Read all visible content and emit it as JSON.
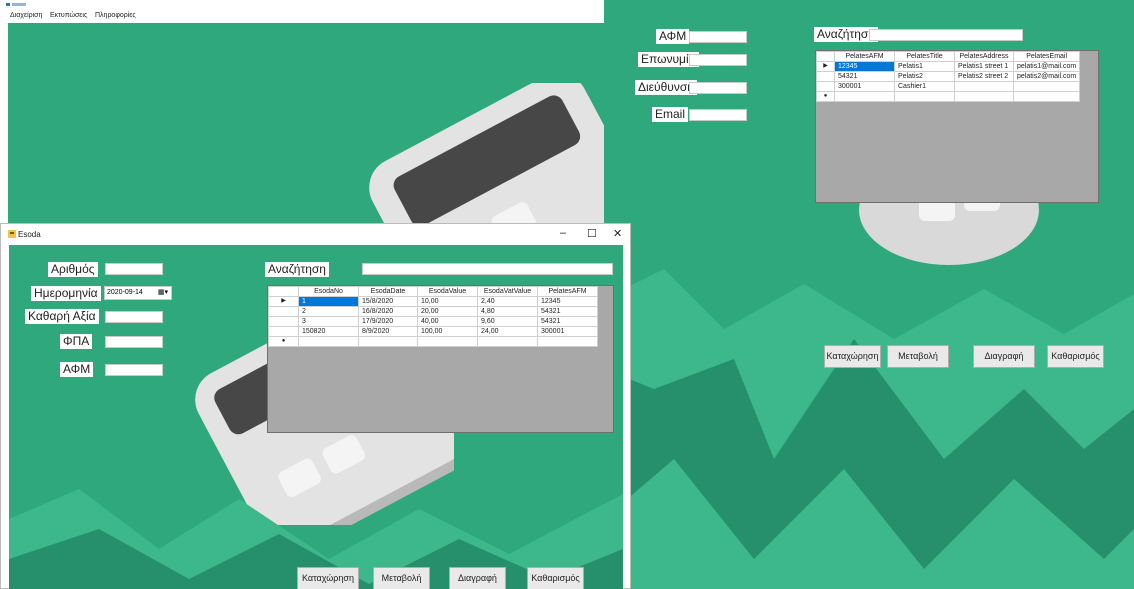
{
  "main": {
    "menu": [
      "Διαχείριση",
      "Εκτυπώσεις",
      "Πληροφορίες"
    ]
  },
  "pelates": {
    "labels": {
      "afm": "ΑΦΜ",
      "eponymia": "Επωνυμία",
      "dieythynsi": "Διεύθυνση",
      "email": "Email",
      "search": "Αναζήτηση"
    },
    "grid": {
      "columns": [
        "PelatesAFM",
        "PelatesTitle",
        "PelatesAddress",
        "PelatesEmail"
      ],
      "rows": [
        [
          "12345",
          "Pelatis1",
          "Pelatis1 street 1",
          "pelatis1@mail.com"
        ],
        [
          "54321",
          "Pelatis2",
          "Pelatis2 street 2",
          "pelatis2@mail.com"
        ],
        [
          "300001",
          "Cashier1",
          "",
          ""
        ]
      ]
    },
    "buttons": {
      "insert": "Καταχώρηση",
      "update": "Μεταβολή",
      "delete": "Διαγραφή",
      "clear": "Καθαρισμός"
    }
  },
  "esoda": {
    "title": "Esoda",
    "labels": {
      "arithmos": "Αριθμός",
      "imerominia": "Ημερομηνία",
      "kathari_axia": "Καθαρή Αξία",
      "fpa": "ΦΠΑ",
      "afm": "ΑΦΜ",
      "search": "Αναζήτηση"
    },
    "date_value": "2020-09-14",
    "grid": {
      "columns": [
        "EsodaNo",
        "EsodaDate",
        "EsodaValue",
        "EsodaVatValue",
        "PelatesAFM"
      ],
      "rows": [
        [
          "1",
          "15/8/2020",
          "10,00",
          "2,40",
          "12345"
        ],
        [
          "2",
          "16/8/2020",
          "20,00",
          "4,80",
          "54321"
        ],
        [
          "3",
          "17/9/2020",
          "40,00",
          "9,60",
          "54321"
        ],
        [
          "150820",
          "8/9/2020",
          "100,00",
          "24,00",
          "300001"
        ]
      ]
    },
    "buttons": {
      "insert": "Καταχώρηση",
      "update": "Μεταβολή",
      "delete": "Διαγραφή",
      "clear": "Καθαρισμός"
    },
    "window_controls": {
      "minimize": "–",
      "maximize": "☐",
      "close": "✕"
    }
  },
  "colors": {
    "background_green": "#2fa87e",
    "mountain_dark": "#25906b",
    "mountain_light": "#3cb88c",
    "selection_blue": "#0078d7"
  },
  "icons": {
    "app": "calculator-app-icon",
    "date_picker": "calendar-dropdown-icon",
    "row_pointer": "row-pointer-icon",
    "new_row": "new-row-icon"
  }
}
